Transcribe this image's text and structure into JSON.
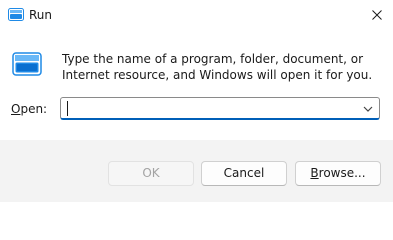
{
  "window": {
    "title": "Run",
    "close_symbol": "✕"
  },
  "icons": {
    "title_icon": "run-icon",
    "content_icon": "run-icon",
    "close_icon": "close-icon",
    "dropdown_icon": "chevron-down-icon"
  },
  "content": {
    "description": "Type the name of a program, folder, document, or Internet resource, and Windows will open it for you."
  },
  "open_field": {
    "label_mnemonic": "O",
    "label_rest": "pen:",
    "value": ""
  },
  "buttons": {
    "ok_label": "OK",
    "ok_enabled": false,
    "cancel_label": "Cancel",
    "browse_mnemonic": "B",
    "browse_rest": "rowse..."
  },
  "colors": {
    "accent": "#005fb8",
    "icon_blue": "#1f8ae6",
    "footer_bg": "#f3f3f3",
    "disabled_text": "#a3a3a3"
  }
}
